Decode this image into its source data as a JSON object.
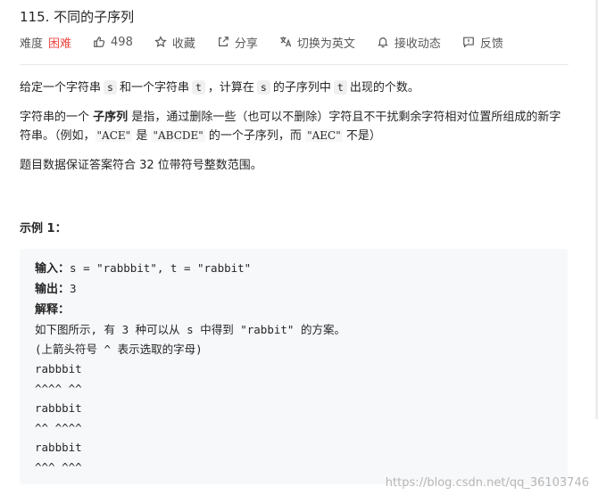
{
  "problem": {
    "title": "115. 不同的子序列",
    "difficulty_label": "难度",
    "difficulty_value": "困难",
    "likes": "498",
    "favorite_label": "收藏",
    "share_label": "分享",
    "translate_label": "切换为英文",
    "notify_label": "接收动态",
    "feedback_label": "反馈",
    "colors": {
      "difficulty_hard": "#ef4743"
    }
  },
  "description": {
    "p1": {
      "t1": "给定一个字符串",
      "c1": "s",
      "t2": "和一个字符串",
      "c2": "t",
      "t3": "，计算在",
      "c3": "s",
      "t4": "的子序列中",
      "c4": "t",
      "t5": "出现的个数。"
    },
    "p2": {
      "t1": "字符串的一个",
      "bold": "子序列",
      "t2": "是指，通过删除一些（也可以不删除）字符且不干扰剩余字符相对位置所组成的新字符串。（例如，",
      "q1": "\"ACE\"",
      "t3": "是",
      "q2": "\"ABCDE\"",
      "t4": "的一个子序列，而",
      "q3": "\"AEC\"",
      "t5": "不是）"
    },
    "p3": "题目数据保证答案符合 32 位带符号整数范围。"
  },
  "example": {
    "title": "示例 1：",
    "input_label": "输入：",
    "input_value": "s = \"rabbbit\", t = \"rabbit\"",
    "output_label": "输出：",
    "output_value": "3",
    "explain_label": "解释：",
    "lines": [
      "如下图所示, 有 3 种可以从 s 中得到 \"rabbit\" 的方案。",
      "(上箭头符号 ^ 表示选取的字母)",
      "rabbbit",
      "^^^^ ^^",
      "rabbbit",
      "^^ ^^^^",
      "rabbbit",
      "^^^ ^^^"
    ]
  },
  "watermark": "https://blog.csdn.net/qq_36103746"
}
